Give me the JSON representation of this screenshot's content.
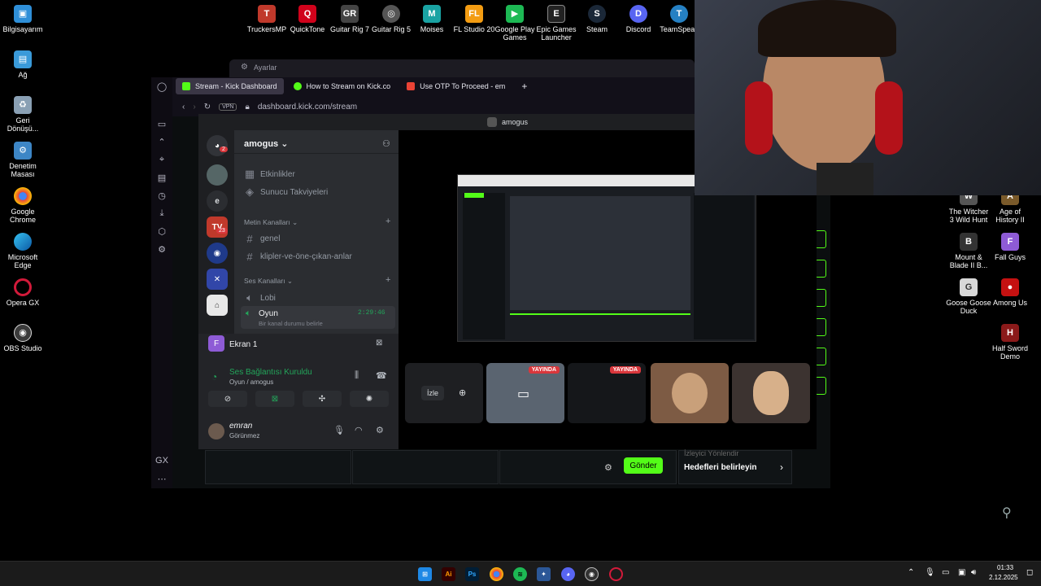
{
  "desktop_left": [
    {
      "label": "Bilgisayarım",
      "icon": "computer-icon",
      "color": "#2f8fd8"
    },
    {
      "label": "Ağ",
      "icon": "network-icon",
      "color": "#3a9ad9"
    },
    {
      "label": "Geri Dönüşü...",
      "icon": "recycle-bin-icon",
      "color": "#8aa0b4"
    },
    {
      "label": "Denetim Masası",
      "icon": "control-panel-icon",
      "color": "#3d86c6"
    },
    {
      "label": "Google Chrome",
      "icon": "chrome-icon",
      "color": "#e8453c"
    },
    {
      "label": "Microsoft Edge",
      "icon": "edge-icon",
      "color": "#1e9bd7"
    },
    {
      "label": "Opera GX",
      "icon": "opera-gx-icon",
      "color": "#d21a3a"
    },
    {
      "label": "OBS Studio",
      "icon": "obs-icon",
      "color": "#3b3b3b"
    }
  ],
  "desktop_top": [
    {
      "label": "TruckersMP",
      "icon": "truck-icon",
      "color": "#c0392b"
    },
    {
      "label": "QuickTone",
      "icon": "quicktone-icon",
      "color": "#d0021b"
    },
    {
      "label": "Guitar Rig 7",
      "icon": "guitar-rig-icon",
      "color": "#444"
    },
    {
      "label": "Guitar Rig 5",
      "icon": "guitar-rig-icon",
      "color": "#555"
    },
    {
      "label": "Moises",
      "icon": "moises-icon",
      "color": "#1aa3a3"
    },
    {
      "label": "FL Studio 20",
      "icon": "fl-studio-icon",
      "color": "#f39c12"
    },
    {
      "label": "Google Play Games",
      "icon": "play-games-icon",
      "color": "#1db954"
    },
    {
      "label": "Epic Games Launcher",
      "icon": "epic-icon",
      "color": "#222"
    },
    {
      "label": "Steam",
      "icon": "steam-icon",
      "color": "#1b2838"
    },
    {
      "label": "Discord",
      "icon": "discord-icon",
      "color": "#5865f2"
    },
    {
      "label": "TeamSpeak",
      "icon": "teamspeak-icon",
      "color": "#2580c3"
    }
  ],
  "desktop_right": [
    {
      "label": "The Witcher 3 Wild Hunt",
      "icon": "witcher-icon",
      "color": "#555"
    },
    {
      "label": "Age of History II",
      "icon": "age-of-history-icon",
      "color": "#7a5a2a"
    },
    {
      "label": "Mount & Blade II B...",
      "icon": "bannerlord-icon",
      "color": "#333"
    },
    {
      "label": "Fall Guys",
      "icon": "fall-guys-icon",
      "color": "#8e5bd6"
    },
    {
      "label": "Goose Goose Duck",
      "icon": "goose-icon",
      "color": "#d8d8d8"
    },
    {
      "label": "Among Us",
      "icon": "among-us-icon",
      "color": "#c51111"
    },
    {
      "label": "Half Sword Demo",
      "icon": "half-sword-icon",
      "color": "#8b1a1a"
    }
  ],
  "settings_window": {
    "title": "Ayarlar"
  },
  "browser": {
    "tabs": [
      {
        "label": "Stream - Kick Dashboard",
        "color": "#53fc18"
      },
      {
        "label": "How to Stream on Kick.co",
        "color": "#53fc18"
      },
      {
        "label": "Use OTP To Proceed - em",
        "color": "#ea4335"
      }
    ],
    "new_tab": "+",
    "vpn_badge": "VPN",
    "url": "dashboard.kick.com/stream"
  },
  "kick_page": {
    "send_button": "Gönder",
    "goals_link": "Hedefleri belirleyin",
    "viewer_hint": "İzleyici Yönlendir"
  },
  "discord": {
    "window_title": "amogus",
    "server_name": "amogus",
    "items": [
      "Etkinlikler",
      "Sunucu Takviyeleri"
    ],
    "text_category": "Metin Kanalları",
    "text_channels": [
      "genel",
      "klipler-ve-öne-çıkan-anlar"
    ],
    "voice_category": "Ses Kanalları",
    "voice_channels": [
      "Lobi",
      "Oyun"
    ],
    "oyun_timer": "2:29:46",
    "oyun_status": "Bir kanal durumu belirle",
    "screen_share": {
      "label": "Ekran 1"
    },
    "voice": {
      "status": "Ses Bağlantısı Kuruldu",
      "channel": "Oyun / amogus"
    },
    "user": {
      "name": "emran",
      "status": "Görünmez"
    },
    "tiles": {
      "watch_label": "İzle",
      "live_label": "YAYINDA"
    },
    "badges": {
      "rail_home": "2",
      "rail_server": "23"
    }
  },
  "taskbar": {
    "time": "01:33",
    "date": "2.12.2025",
    "apps": [
      "windows-start-icon",
      "illustrator-icon",
      "photoshop-icon",
      "chrome-icon",
      "spotify-icon",
      "vpn-icon",
      "discord-icon",
      "obs-icon",
      "opera-gx-icon"
    ]
  },
  "colors": {
    "kick_green": "#53fc18",
    "discord_blurple": "#5865f2",
    "voice_green": "#23a55a",
    "live_red": "#da373c"
  }
}
